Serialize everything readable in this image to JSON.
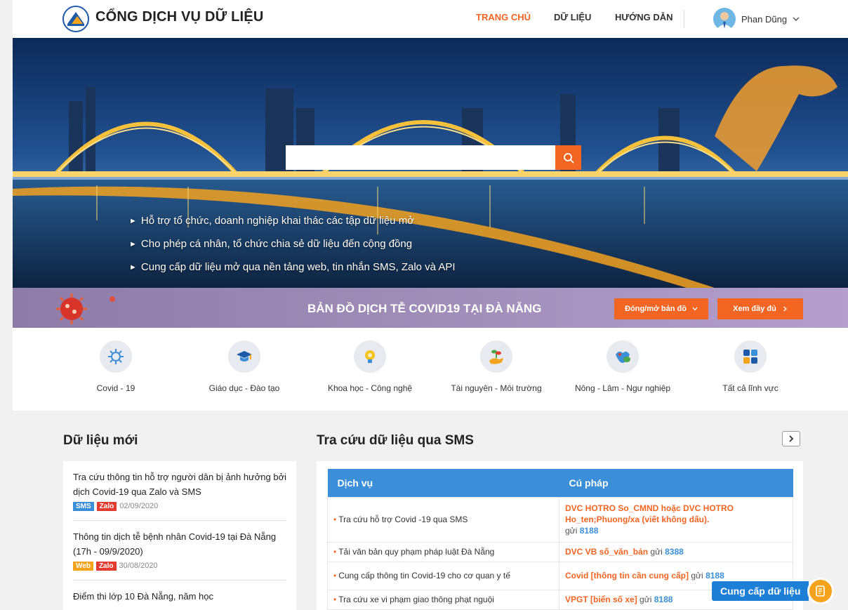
{
  "header": {
    "site_title": "CỔNG DỊCH VỤ DỮ LIỆU",
    "nav": [
      {
        "label": "TRANG CHỦ",
        "active": true
      },
      {
        "label": "DỮ LIỆU",
        "active": false
      },
      {
        "label": "HƯỚNG DẪN",
        "active": false
      }
    ],
    "user_name": "Phan Dũng"
  },
  "hero": {
    "search_placeholder": "",
    "bullets": [
      "Hỗ trợ tổ chức, doanh nghiệp khai thác các tập dữ liệu mở",
      "Cho phép cá nhân, tổ chức chia sẻ dữ liệu đến cộng đồng",
      "Cung cấp dữ liệu mở qua nền tảng web, tin nhắn SMS, Zalo và API"
    ]
  },
  "covid_banner": {
    "title": "BẢN ĐỒ DỊCH TỄ COVID19 TẠI ĐÀ NẴNG",
    "toggle_label": "Đóng/mở bản đồ",
    "view_full_label": "Xem đầy đủ"
  },
  "categories": [
    {
      "label": "Covid - 19",
      "icon": "virus-icon"
    },
    {
      "label": "Giáo dục - Đào tạo",
      "icon": "graduation-cap-icon"
    },
    {
      "label": "Khoa học - Công nghệ",
      "icon": "lightbulb-icon"
    },
    {
      "label": "Tài nguyên - Môi trường",
      "icon": "plant-hand-icon"
    },
    {
      "label": "Nông - Lâm - Ngư nghiệp",
      "icon": "agriculture-icon"
    },
    {
      "label": "Tất cả lĩnh vực",
      "icon": "grid-icon"
    }
  ],
  "new_data": {
    "title": "Dữ liệu mới",
    "items": [
      {
        "title": "Tra cứu thông tin hỗ trợ người dân bị ảnh hưởng bởi dịch Covid-19 qua Zalo và SMS",
        "tags": [
          "SMS",
          "Zalo"
        ],
        "date": "02/09/2020"
      },
      {
        "title": "Thông tin dịch tễ bệnh nhân Covid-19 tại Đà Nẵng (17h - 09/9/2020)",
        "tags": [
          "Web",
          "Zalo"
        ],
        "date": "30/08/2020"
      },
      {
        "title": "Điểm thi lớp 10 Đà Nẵng, năm học",
        "tags": [],
        "date": ""
      }
    ]
  },
  "sms": {
    "title": "Tra cứu dữ liệu qua SMS",
    "col_service": "Dịch vụ",
    "col_syntax": "Cú pháp",
    "send_word": "gửi",
    "rows": [
      {
        "service": "Tra cứu hỗ trợ Covid -19 qua SMS",
        "cmd": "DVC HOTRO So_CMND hoặc DVC HOTRO Ho_ten;Phuong/xa (viết không dấu).",
        "number": "8188"
      },
      {
        "service": "Tải văn bản quy phạm pháp luật Đà Nẵng",
        "cmd": "DVC VB số_văn_bản",
        "number": "8388"
      },
      {
        "service": "Cung cấp thông tin Covid-19 cho cơ quan y tế",
        "cmd": "Covid [thông tin cần cung cấp]",
        "number": "8188"
      },
      {
        "service": "Tra cứu xe vi phạm giao thông phạt nguội",
        "cmd": "VPGT [biển số xe]",
        "number": "8188"
      }
    ]
  },
  "floating": {
    "label": "Cung cấp dữ liệu"
  },
  "colors": {
    "accent": "#f26522",
    "blue": "#3b8fd8",
    "banner": "#a18fba"
  }
}
